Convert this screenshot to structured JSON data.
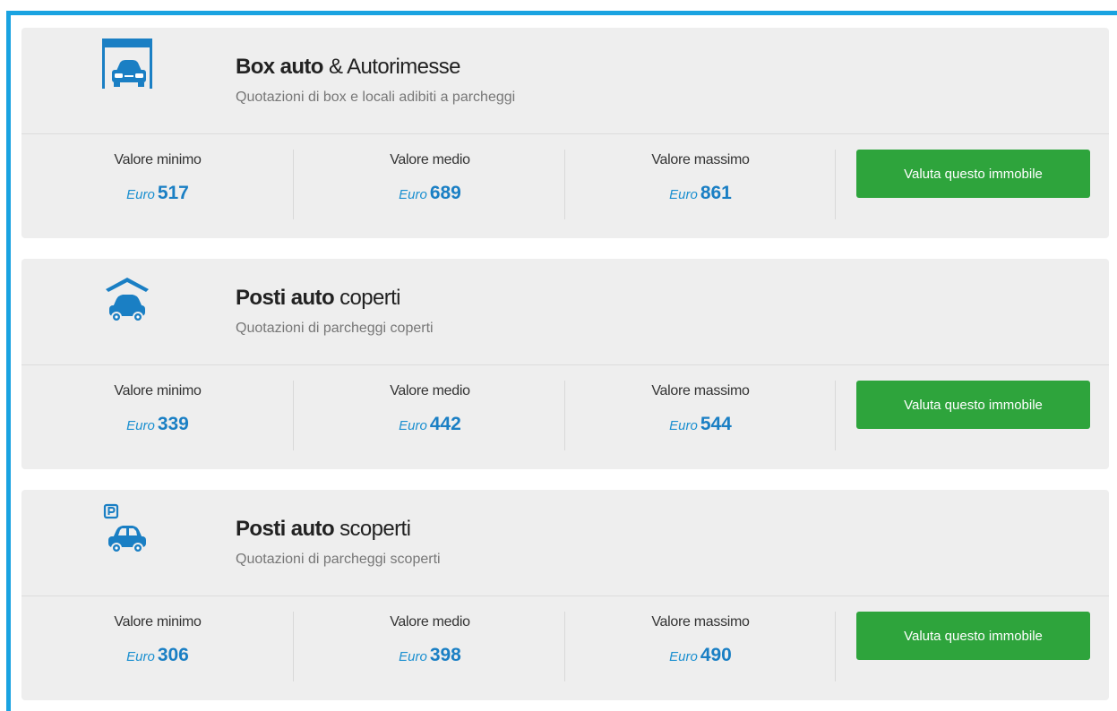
{
  "colors": {
    "frame": "#1aa3e1",
    "card_bg": "#eeeeee",
    "icon": "#1a7fc4",
    "price": "#1a7fc4",
    "button": "#2ea43c"
  },
  "cards": [
    {
      "icon": "garage-car-icon",
      "title_bold": "Box auto",
      "title_rest": " & Autorimesse",
      "subtitle": "Quotazioni di box e locali adibiti a parcheggi",
      "min_label": "Valore minimo",
      "med_label": "Valore medio",
      "max_label": "Valore massimo",
      "currency": "Euro",
      "min_value": "517",
      "med_value": "689",
      "max_value": "861",
      "button_label": "Valuta questo immobile"
    },
    {
      "icon": "covered-parking-icon",
      "title_bold": "Posti auto",
      "title_rest": " coperti",
      "subtitle": "Quotazioni di parcheggi coperti",
      "min_label": "Valore minimo",
      "med_label": "Valore medio",
      "max_label": "Valore massimo",
      "currency": "Euro",
      "min_value": "339",
      "med_value": "442",
      "max_value": "544",
      "button_label": "Valuta questo immobile"
    },
    {
      "icon": "open-parking-icon",
      "title_bold": "Posti auto",
      "title_rest": " scoperti",
      "subtitle": "Quotazioni di parcheggi scoperti",
      "min_label": "Valore minimo",
      "med_label": "Valore medio",
      "max_label": "Valore massimo",
      "currency": "Euro",
      "min_value": "306",
      "med_value": "398",
      "max_value": "490",
      "button_label": "Valuta questo immobile"
    }
  ]
}
